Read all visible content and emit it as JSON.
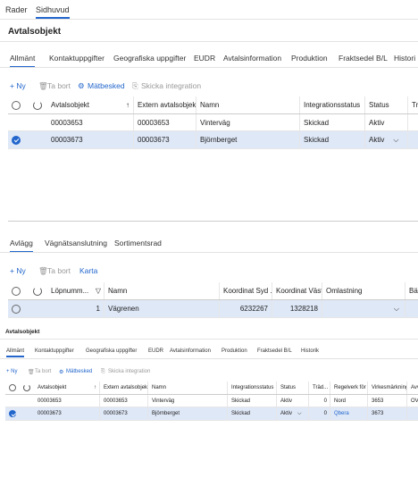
{
  "top_tabs": [
    "Rader",
    "Sidhuvud"
  ],
  "section1": {
    "title": "Avtalsobjekt",
    "tabs": [
      "Allmänt",
      "Kontaktuppgifter",
      "Geografiska uppgifter",
      "EUDR",
      "Avtalsinformation",
      "Produktion",
      "Fraktsedel B/L",
      "Histori"
    ],
    "toolbar": {
      "new": "+ Ny",
      "delete": "Ta bort",
      "meas": "Mätbesked",
      "send": "Skicka integration"
    },
    "columns": [
      "Avtalsobjekt",
      "Extern avtalsobjek...",
      "Namn",
      "Integrationsstatus",
      "Status",
      "Träd"
    ],
    "sort_mark": "↑",
    "rows": [
      {
        "id": "00003653",
        "ext": "00003653",
        "name": "Vinterväg",
        "integ": "Skickad",
        "status": "Aktiv"
      },
      {
        "id": "00003673",
        "ext": "00003673",
        "name": "Björnberget",
        "integ": "Skickad",
        "status": "Aktiv"
      }
    ]
  },
  "section2": {
    "tabs": [
      "Avlägg",
      "Vägnätsanslutning",
      "Sortimentsrad"
    ],
    "toolbar": {
      "new": "+ Ny",
      "delete": "Ta bort",
      "map": "Karta"
    },
    "columns": [
      "Löpnumm...",
      "Namn",
      "Koordinat Syd ...",
      "Koordinat Väst...",
      "Omlastning",
      "Bärig"
    ],
    "rows": [
      {
        "num": "1",
        "name": "Vägrenen",
        "syd": "6232267",
        "vast": "1328218",
        "oml": ""
      }
    ]
  },
  "section3": {
    "title": "Avtalsobjekt",
    "tabs": [
      "Allmänt",
      "Kontaktuppgifter",
      "Geografiska uppgifter",
      "EUDR",
      "Avtalsinformation",
      "Produktion",
      "Fraktsedel B/L",
      "Historik"
    ],
    "toolbar": {
      "new": "+ Ny",
      "delete": "Ta bort",
      "meas": "Mätbesked",
      "send": "Skicka integration"
    },
    "columns": [
      "Avtalsobjekt",
      "Extern avtalsobjek...",
      "Namn",
      "Integrationsstatus",
      "Status",
      "Träd...",
      "Regelverk för ...",
      "Virkesmärkning",
      "Avve"
    ],
    "rows": [
      {
        "id": "00003653",
        "ext": "00003653",
        "name": "Vinterväg",
        "integ": "Skickad",
        "status": "Aktiv",
        "trad": "0",
        "regel": "Nord",
        "virke": "3653",
        "avve": "OV"
      },
      {
        "id": "00003673",
        "ext": "00003673",
        "name": "Björnberget",
        "integ": "Skickad",
        "status": "Aktiv",
        "trad": "0",
        "regel": "Qbera",
        "virke": "3673",
        "avve": ""
      }
    ]
  }
}
